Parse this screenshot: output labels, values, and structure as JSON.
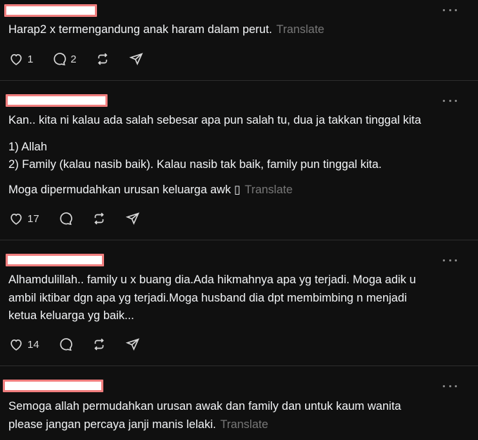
{
  "posts": [
    {
      "lines": [
        "Harap2 x termengandung anak haram dalam perut."
      ],
      "translate": "Translate",
      "likes": "1",
      "replies": "2"
    },
    {
      "lines": [
        "Kan.. kita ni kalau ada salah sebesar apa pun salah tu, dua ja takkan tinggal kita",
        "1) Allah",
        "2) Family (kalau nasib baik). Kalau nasib tak baik, family pun tinggal kita.",
        "Moga dipermudahkan urusan keluarga awk ▯"
      ],
      "translate": "Translate",
      "likes": "17",
      "replies": ""
    },
    {
      "lines": [
        "Alhamdulillah.. family u x buang dia.Ada hikmahnya apa yg terjadi. Moga adik u",
        "ambil iktibar dgn apa yg terjadi.Moga husband dia dpt membimbing n menjadi",
        "ketua keluarga yg baik..."
      ],
      "translate": "",
      "likes": "14",
      "replies": ""
    },
    {
      "lines": [
        "Semoga allah permudahkan urusan awak dan family dan untuk kaum wanita",
        "please jangan percaya janji manis lelaki."
      ],
      "translate": "Translate",
      "likes": "",
      "replies": ""
    }
  ],
  "icons": {
    "like": "heart-icon",
    "reply": "comment-icon",
    "repost": "repost-icon",
    "share": "send-icon",
    "more": "more-icon"
  }
}
